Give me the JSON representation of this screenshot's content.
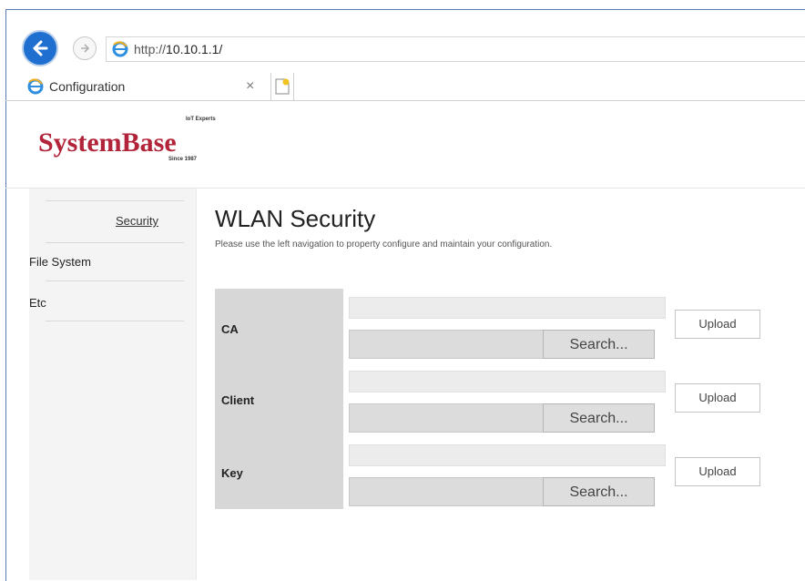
{
  "browser": {
    "url_prefix": "http://",
    "url_host": "10.10.1.1/",
    "tab_title": "Configuration",
    "tab_close": "×"
  },
  "logo": {
    "name": "SystemBase",
    "tagline": "IoT Experts",
    "since": "Since 1987",
    "brand_color": "#b2243a"
  },
  "sidebar": {
    "items": [
      {
        "label": "Security",
        "active": true
      },
      {
        "label": "File System",
        "active": false
      },
      {
        "label": "Etc",
        "active": false
      }
    ]
  },
  "main": {
    "title": "WLAN Security",
    "subtitle": "Please use the left navigation to property configure and maintain your configuration.",
    "rows": [
      {
        "label": "CA",
        "search_label": "Search...",
        "upload_label": "Upload"
      },
      {
        "label": "Client",
        "search_label": "Search...",
        "upload_label": "Upload"
      },
      {
        "label": "Key",
        "search_label": "Search...",
        "upload_label": "Upload"
      }
    ]
  },
  "icons": {
    "back": "back-arrow-icon",
    "forward": "forward-arrow-icon",
    "page": "ie-page-icon",
    "new_tab": "new-tab-icon"
  }
}
